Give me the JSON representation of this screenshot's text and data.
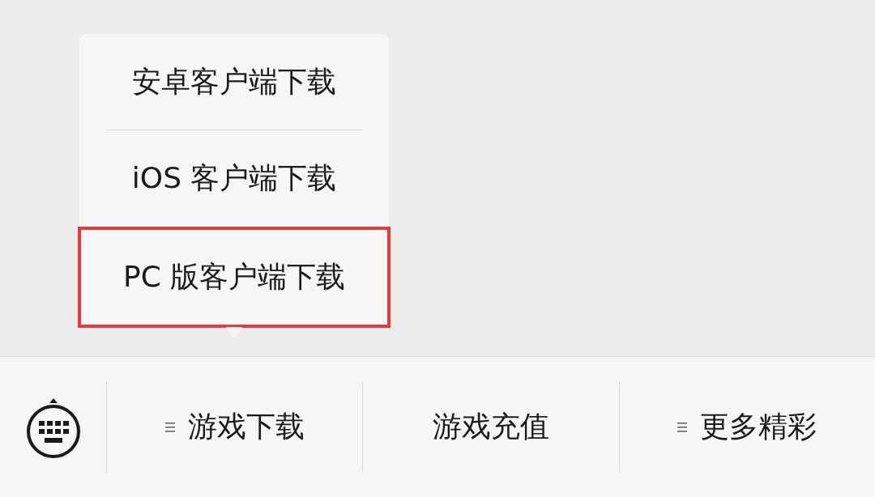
{
  "menu_bar": {
    "items": [
      {
        "label": "游戏下载",
        "has_submenu": true,
        "submenu": {
          "items": [
            {
              "label": "安卓客户端下载",
              "highlighted": false
            },
            {
              "label": "iOS 客户端下载",
              "highlighted": false
            },
            {
              "label": "PC 版客户端下载",
              "highlighted": true
            }
          ]
        }
      },
      {
        "label": "游戏充值",
        "has_submenu": false
      },
      {
        "label": "更多精彩",
        "has_submenu": true
      }
    ]
  }
}
